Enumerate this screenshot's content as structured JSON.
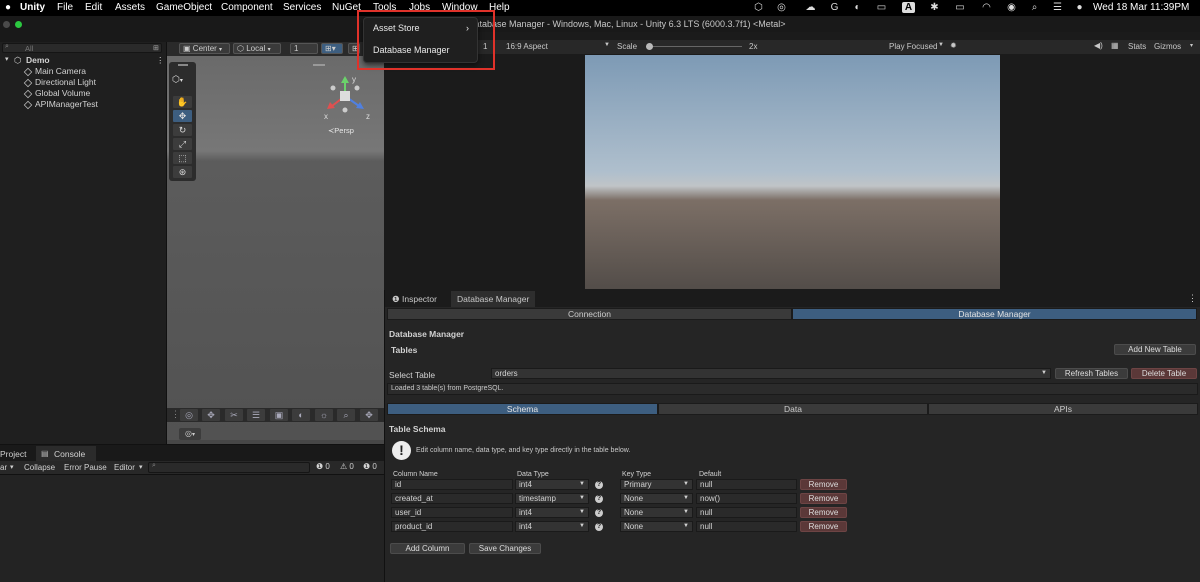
{
  "menubar": {
    "apple_icon": "apple-icon",
    "items": [
      "Unity",
      "File",
      "Edit",
      "Assets",
      "GameObject",
      "Component",
      "Services",
      "NuGet",
      "Tools",
      "Jobs",
      "Window",
      "Help"
    ],
    "clock": "Wed 18 Mar  11:39PM"
  },
  "window": {
    "title": "Database Manager - Windows, Mac, Linux - Unity 6.3 LTS (6000.3.7f1) <Metal>"
  },
  "tools_menu": {
    "items": [
      {
        "label": "Asset Store",
        "has_submenu": true
      },
      {
        "label": "Database Manager",
        "has_submenu": false
      }
    ]
  },
  "hierarchy": {
    "search_placeholder": "All",
    "scene": "Demo",
    "objects": [
      "Main Camera",
      "Directional Light",
      "Global Volume",
      "APIManagerTest"
    ]
  },
  "scene_view": {
    "pivot": "Center",
    "space": "Local",
    "grid_value": "1",
    "persp_label": "≺Persp",
    "axes": {
      "x": "x",
      "y": "y",
      "z": "z"
    }
  },
  "project_panel": {
    "tabs": [
      "Project",
      "Console"
    ],
    "toolbar": {
      "clear": "ar",
      "collapse": "Collapse",
      "error_pause": "Error Pause",
      "editor": "Editor"
    },
    "counts": {
      "info": "0",
      "warn": "0",
      "error": "0"
    }
  },
  "game_view": {
    "display": "1",
    "aspect": "16:9 Aspect",
    "scale_label": "Scale",
    "scale_value": "2x",
    "play_mode": "Play Focused",
    "stats": "Stats",
    "gizmos": "Gizmos"
  },
  "db_panel": {
    "tabs": [
      "Inspector",
      "Database Manager"
    ],
    "segments": [
      "Connection",
      "Database Manager"
    ],
    "active_segment": 1,
    "heading": "Database Manager",
    "tables_label": "Tables",
    "add_table": "Add New Table",
    "select_table_label": "Select Table",
    "selected_table": "orders",
    "refresh": "Refresh Tables",
    "delete": "Delete Table",
    "status": "Loaded 3 table(s) from PostgreSQL.",
    "sub_tabs": [
      "Schema",
      "Data",
      "APIs"
    ],
    "active_sub_tab": 0,
    "schema_title": "Table Schema",
    "info_text": "Edit column name, data type, and key type directly in the table below.",
    "columns_header": [
      "Column Name",
      "Data Type",
      "Key Type",
      "Default"
    ],
    "rows": [
      {
        "name": "id",
        "type": "int4",
        "key": "Primary",
        "default": "null",
        "remove": "Remove"
      },
      {
        "name": "created_at",
        "type": "timestamp",
        "key": "None",
        "default": "now()",
        "remove": "Remove"
      },
      {
        "name": "user_id",
        "type": "int4",
        "key": "None",
        "default": "null",
        "remove": "Remove"
      },
      {
        "name": "product_id",
        "type": "int4",
        "key": "None",
        "default": "null",
        "remove": "Remove"
      }
    ],
    "add_column": "Add Column",
    "save": "Save Changes"
  },
  "colors": {
    "accent": "#3d5e80",
    "danger": "#5b3838",
    "highlight": "#e0322a"
  }
}
